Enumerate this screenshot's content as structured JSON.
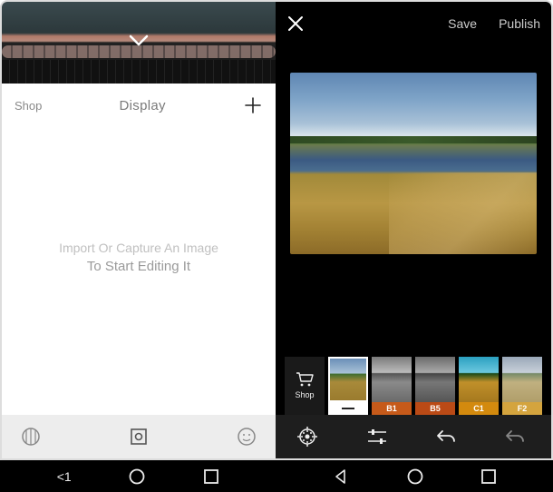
{
  "left": {
    "header": {
      "shop": "Shop",
      "title": "Display",
      "add_tooltip": "Add"
    },
    "empty": {
      "line1": "Import Or Capture An Image",
      "line2": "To Start Editing It"
    },
    "toolbar": {
      "layers_icon": "layers",
      "capture_icon": "capture",
      "face_icon": "face"
    }
  },
  "right": {
    "top": {
      "save": "Save",
      "publish": "Publish"
    },
    "filters": {
      "shop_label": "Shop",
      "items": [
        {
          "id": "orig",
          "label": ""
        },
        {
          "id": "b1",
          "label": "B1"
        },
        {
          "id": "b5",
          "label": "B5"
        },
        {
          "id": "c1",
          "label": "C1"
        },
        {
          "id": "f2",
          "label": "F2"
        }
      ]
    },
    "tools": {
      "presets": "presets",
      "adjust": "adjust",
      "undo": "undo",
      "redo": "redo"
    }
  },
  "sysnav": {
    "left_back_label": "<1"
  }
}
